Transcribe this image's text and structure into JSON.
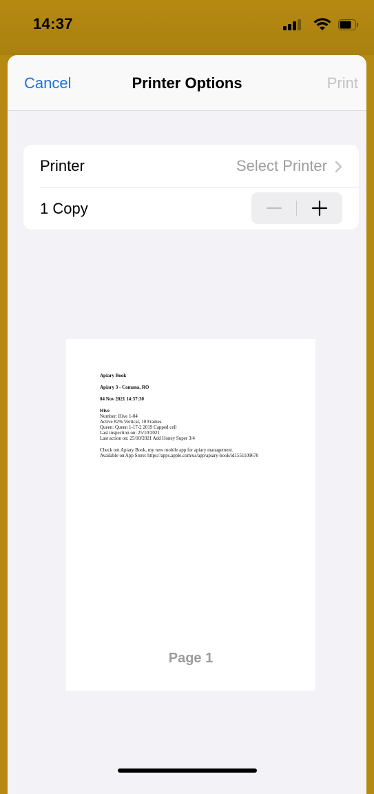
{
  "status_bar": {
    "time": "14:37"
  },
  "nav": {
    "cancel_label": "Cancel",
    "title": "Printer Options",
    "print_label": "Print"
  },
  "options": {
    "printer_label": "Printer",
    "printer_value": "Select Printer",
    "copies_label": "1 Copy"
  },
  "preview": {
    "app_name": "Apiary Book",
    "apiary": "Apiary 3 - Comana, RO",
    "datetime": "04 Nov 2021 14:37:30",
    "section_title": "Hive",
    "details": [
      "Number: Hive 1-04",
      "Active 82% Vertical, 10 Frames",
      "Queen: Queen 1-17-2 2019 Capped cell",
      "Last inspection on: 25/10/2021",
      "Last action on: 25/10/2021 Add Honey Super 3/4"
    ],
    "promo": [
      "Check out Apiary Book, my new mobile app for apiary management.",
      "Available on App Store: https://apps.apple.com/us/app/apiary-book/id1551109670"
    ],
    "page_label": "Page 1"
  },
  "colors": {
    "status_bar_bg": "#b68a12",
    "accent": "#1a73d9",
    "disabled": "#c3c3c7"
  }
}
